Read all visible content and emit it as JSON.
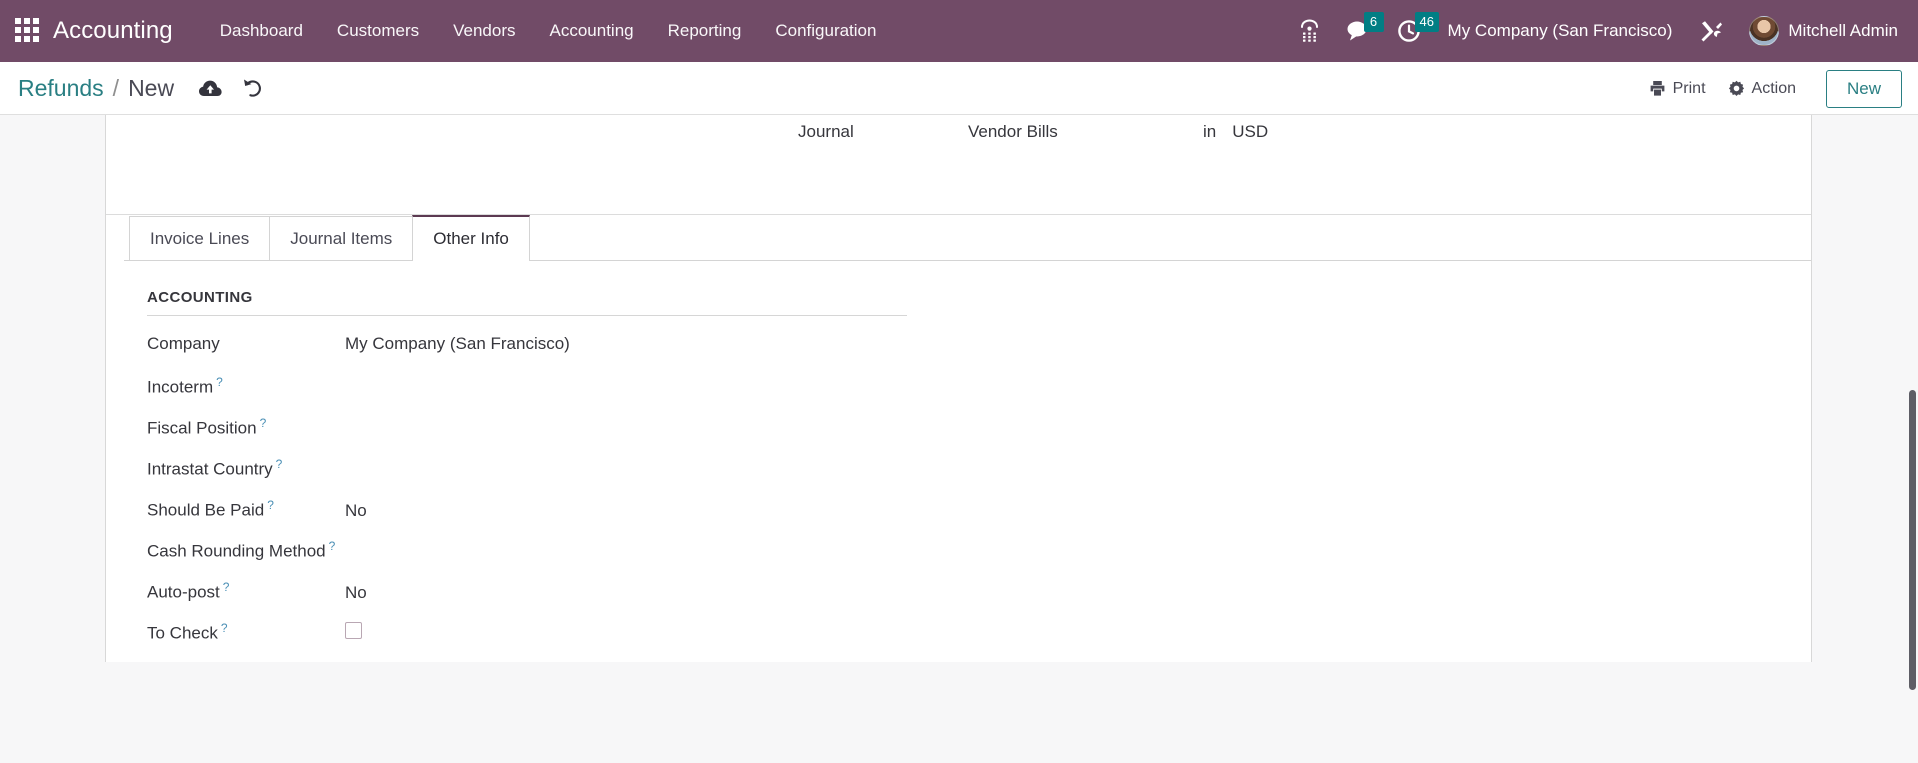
{
  "navbar": {
    "apps_icon": "apps-grid-icon",
    "brand": "Accounting",
    "menu": [
      {
        "label": "Dashboard"
      },
      {
        "label": "Customers"
      },
      {
        "label": "Vendors"
      },
      {
        "label": "Accounting"
      },
      {
        "label": "Reporting"
      },
      {
        "label": "Configuration"
      }
    ],
    "voip_icon": "dialpad-phone-icon",
    "messages": {
      "icon": "speech-bubble-icon",
      "count": "6"
    },
    "activities": {
      "icon": "clock-icon",
      "count": "46"
    },
    "company": "My Company (San Francisco)",
    "tools_icon": "wrench-screwdriver-icon",
    "user": "Mitchell Admin",
    "bg_color": "#714B67",
    "badge_color": "#017e84"
  },
  "control_panel": {
    "breadcrumb_root": "Refunds",
    "breadcrumb_separator": "/",
    "breadcrumb_current": "New",
    "save_icon": "cloud-upload-icon",
    "discard_icon": "undo-arrow-icon",
    "print_label": "Print",
    "print_icon": "printer-icon",
    "action_label": "Action",
    "action_icon": "gear-icon",
    "new_label": "New",
    "accent_color": "#2a7f83"
  },
  "form": {
    "journal": {
      "label": "Journal",
      "value": "Vendor Bills",
      "in_word": "in",
      "currency": "USD"
    },
    "tabs": [
      {
        "label": "Invoice Lines",
        "active": false
      },
      {
        "label": "Journal Items",
        "active": false
      },
      {
        "label": "Other Info",
        "active": true
      }
    ],
    "group_title": "ACCOUNTING",
    "help_marker": "?",
    "fields": [
      {
        "label": "Company",
        "value": "My Company (San Francisco)",
        "help": false,
        "type": "text"
      },
      {
        "label": "Incoterm",
        "value": "",
        "help": true,
        "type": "text"
      },
      {
        "label": "Fiscal Position",
        "value": "",
        "help": true,
        "type": "text"
      },
      {
        "label": "Intrastat Country",
        "value": "",
        "help": true,
        "type": "text"
      },
      {
        "label": "Should Be Paid",
        "value": "No",
        "help": true,
        "type": "text"
      },
      {
        "label": "Cash Rounding Method",
        "value": "",
        "help": true,
        "type": "text"
      },
      {
        "label": "Auto-post",
        "value": "No",
        "help": true,
        "type": "text"
      },
      {
        "label": "To Check",
        "value": "",
        "help": true,
        "type": "checkbox",
        "checked": false
      }
    ]
  }
}
